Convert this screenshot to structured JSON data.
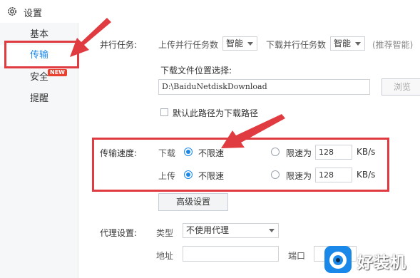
{
  "window": {
    "title": "设置",
    "icon": "gear-icon"
  },
  "sidebar": {
    "items": [
      {
        "label": "基本"
      },
      {
        "label": "传输",
        "active": true
      },
      {
        "label": "安全",
        "badge": "NEW"
      },
      {
        "label": "提醒"
      }
    ]
  },
  "parallel": {
    "label": "并行任务:",
    "upload_label": "上传并行任务数",
    "upload_value": "智能",
    "download_label": "下载并行任务数",
    "download_value": "智能",
    "hint": "(推荐智能)"
  },
  "location": {
    "label": "下载文件位置选择:",
    "path": "D:\\BaiduNetdiskDownload",
    "browse_label": "浏览",
    "default_checkbox_label": "默认此路径为下载路径",
    "default_checked": false
  },
  "speed": {
    "label": "传输速度:",
    "rows": [
      {
        "direction": "下载",
        "unlimited_label": "不限速",
        "limit_label": "限速为",
        "limit_value": "128",
        "unit": "KB/s",
        "selected": "unlimited"
      },
      {
        "direction": "上传",
        "unlimited_label": "不限速",
        "limit_label": "限速为",
        "limit_value": "128",
        "unit": "KB/s",
        "selected": "unlimited"
      }
    ]
  },
  "advanced": {
    "label": "高级设置"
  },
  "proxy": {
    "label": "代理设置:",
    "type_label": "类型",
    "type_value": "不使用代理",
    "address_label": "地址",
    "address_value": "",
    "port_label": "端口",
    "port_value": ""
  },
  "watermark": {
    "text": "好装机"
  },
  "colors": {
    "accent": "#1a88e8",
    "highlight_red": "#e03b41",
    "sidebar_bg": "#f6f7f9"
  }
}
